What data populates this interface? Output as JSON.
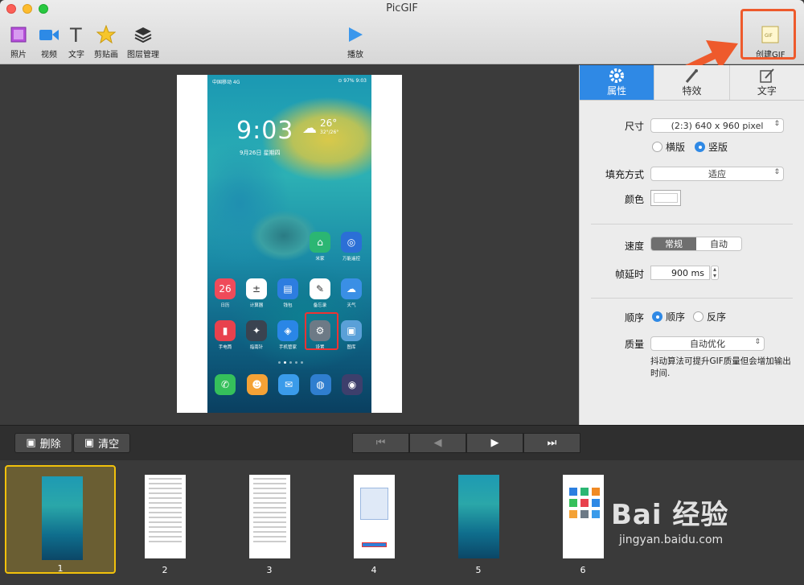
{
  "window": {
    "title": "PicGIF"
  },
  "toolbar": {
    "items": [
      {
        "label": "照片",
        "icon": "photo-icon"
      },
      {
        "label": "视频",
        "icon": "video-icon"
      },
      {
        "label": "文字",
        "icon": "text-icon"
      },
      {
        "label": "剪贴画",
        "icon": "star-icon"
      },
      {
        "label": "图层管理",
        "icon": "layers-icon"
      }
    ],
    "play_label": "播放",
    "create_label": "创建GIF",
    "create_icon_text": "GIF"
  },
  "phone": {
    "status_left": "中国移动 4G",
    "status_right": "⊙ 97% 9:03",
    "time": "9:03",
    "weather_temp": "26°",
    "weather_range": "32°/26°",
    "date": "9月26日 星期四",
    "apps": [
      {
        "label": "米家",
        "color": "#2bb673",
        "glyph": "⌂"
      },
      {
        "label": "万能遥控",
        "color": "#2b6fd6",
        "glyph": "◎"
      },
      {
        "label": "日历",
        "color": "#ef4b5a",
        "glyph": "26"
      },
      {
        "label": "计算器",
        "color": "#ffffff",
        "glyph": "±"
      },
      {
        "label": "钱包",
        "color": "#2d7de0",
        "glyph": "▤"
      },
      {
        "label": "备忘录",
        "color": "#ffffff",
        "glyph": "✎"
      },
      {
        "label": "天气",
        "color": "#3a8fe5",
        "glyph": "☁"
      },
      {
        "label": "手电筒",
        "color": "#e8414d",
        "glyph": "▮"
      },
      {
        "label": "指南针",
        "color": "#3a4350",
        "glyph": "✦"
      },
      {
        "label": "手机管家",
        "color": "#2a86e6",
        "glyph": "◈"
      },
      {
        "label": "设置",
        "color": "#6d7a86",
        "glyph": "⚙"
      },
      {
        "label": "图库",
        "color": "#5aa0d8",
        "glyph": "▣"
      }
    ],
    "dock": [
      {
        "color": "#35c05b",
        "glyph": "✆"
      },
      {
        "color": "#f4a236",
        "glyph": "☻"
      },
      {
        "color": "#3a9bea",
        "glyph": "✉"
      },
      {
        "color": "#2f7ecf",
        "glyph": "◍"
      },
      {
        "color": "#3d3f6c",
        "glyph": "◉"
      }
    ]
  },
  "panel": {
    "tabs": [
      {
        "label": "属性",
        "icon": "gear-icon"
      },
      {
        "label": "特效",
        "icon": "magic-wand-icon"
      },
      {
        "label": "文字",
        "icon": "edit-icon"
      }
    ],
    "size_label": "尺寸",
    "size_value": "(2:3) 640 x 960 pixel",
    "orientation": {
      "landscape": "横版",
      "portrait": "竖版",
      "selected": "portrait"
    },
    "fill_label": "填充方式",
    "fill_value": "适应",
    "color_label": "颜色",
    "color_value": "#ffffff",
    "speed_label": "速度",
    "speed_options": [
      "常规",
      "自动"
    ],
    "delay_label": "帧延时",
    "delay_value": "900 ms",
    "order_label": "顺序",
    "order_options": [
      "顺序",
      "反序"
    ],
    "quality_label": "质量",
    "quality_value": "自动优化",
    "quality_note": "抖动算法可提升GIF质量但会增加输出时间."
  },
  "controls": {
    "delete_label": "删除",
    "clear_label": "清空"
  },
  "frames": [
    {
      "num": "1",
      "type": "phone",
      "selected": true
    },
    {
      "num": "2",
      "type": "list"
    },
    {
      "num": "3",
      "type": "list"
    },
    {
      "num": "4",
      "type": "dialog"
    },
    {
      "num": "5",
      "type": "phone"
    },
    {
      "num": "6",
      "type": "grid"
    }
  ],
  "watermark": {
    "brand": "Bai 经验",
    "url": "jingyan.baidu.com"
  },
  "colors": {
    "accent": "#2f89e5",
    "highlight": "#ee5a2c",
    "selected_frame": "#f1c10b"
  }
}
